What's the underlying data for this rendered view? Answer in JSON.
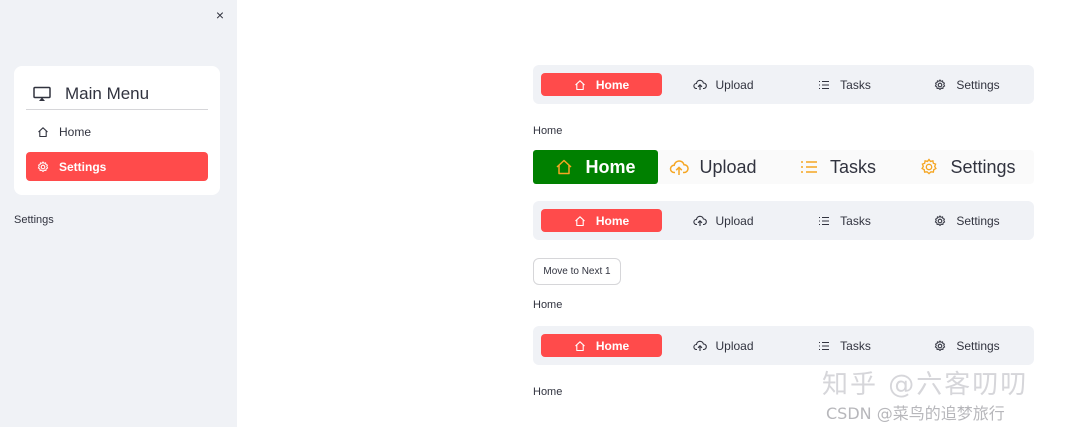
{
  "sidebar": {
    "close_label": "×",
    "menu_title": "Main Menu",
    "menu_items": [
      {
        "label": "Home",
        "icon": "house-icon",
        "active": false
      },
      {
        "label": "Settings",
        "icon": "gear-icon",
        "active": true
      }
    ],
    "selected_text": "Settings"
  },
  "nav_items": [
    "Home",
    "Upload",
    "Tasks",
    "Settings"
  ],
  "nav_bar_1": {
    "active": "Home"
  },
  "label_1": "Home",
  "nav_bar_large": {
    "active": "Home",
    "active_bg": "#008000",
    "icon_color": "#f5a623"
  },
  "nav_bar_2": {
    "active": "Home"
  },
  "move_button": "Move to Next 1",
  "label_2": "Home",
  "nav_bar_3": {
    "active": "Home"
  },
  "label_3": "Home",
  "watermark": {
    "line1": "知乎 @六客叨叨",
    "line2": "CSDN @菜鸟的追梦旅行"
  },
  "colors": {
    "accent": "#ff4b4b",
    "sidebar_bg": "#f0f2f6",
    "nav_bg": "#f0f2f6"
  }
}
